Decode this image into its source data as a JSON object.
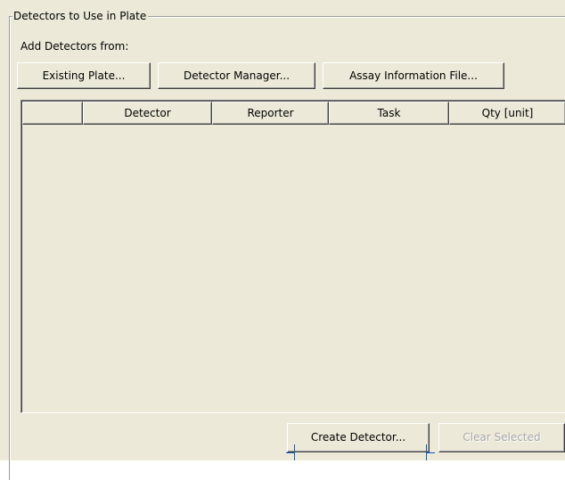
{
  "group": {
    "title": "Detectors to Use in Plate",
    "add_label": "Add Detectors from:"
  },
  "source_buttons": {
    "existing_plate": "Existing Plate...",
    "detector_manager": "Detector Manager...",
    "assay_information_file": "Assay Information File..."
  },
  "table": {
    "columns": [
      "",
      "Detector",
      "Reporter",
      "Task",
      "Qty [unit]"
    ],
    "rows": []
  },
  "actions": {
    "create_detector": "Create Detector...",
    "clear_selected": "Clear Selected",
    "clear_selected_enabled": false
  },
  "colors": {
    "dialog_background": "#ece9d8",
    "disabled_text": "#a7a6aa",
    "callout_line": "#0a5cc8"
  }
}
